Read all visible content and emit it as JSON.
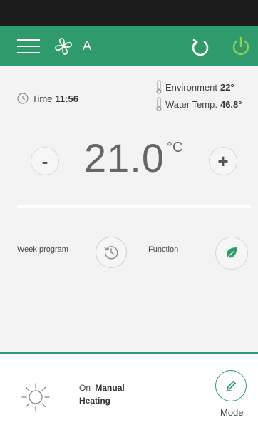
{
  "header": {
    "fan_mode": "A",
    "accent_color": "#2f9a6c"
  },
  "info": {
    "time_label": "Time",
    "time_value": "11:56",
    "environment_label": "Environment",
    "environment_value": "22°",
    "water_label": "Water Temp.",
    "water_value": "46.8°"
  },
  "setpoint": {
    "value": "21.0",
    "unit": "°C",
    "minus_label": "-",
    "plus_label": "+"
  },
  "controls": {
    "week_program_label": "Week program",
    "function_label": "Function"
  },
  "status": {
    "state": "On",
    "mode_name": "Manual",
    "activity": "Heating",
    "mode_button_label": "Mode"
  },
  "icons": [
    "menu-icon",
    "fan-icon",
    "refresh-icon",
    "power-icon",
    "clock-icon",
    "thermometer-icon",
    "history-icon",
    "leaf-icon",
    "sun-icon",
    "pencil-icon"
  ]
}
